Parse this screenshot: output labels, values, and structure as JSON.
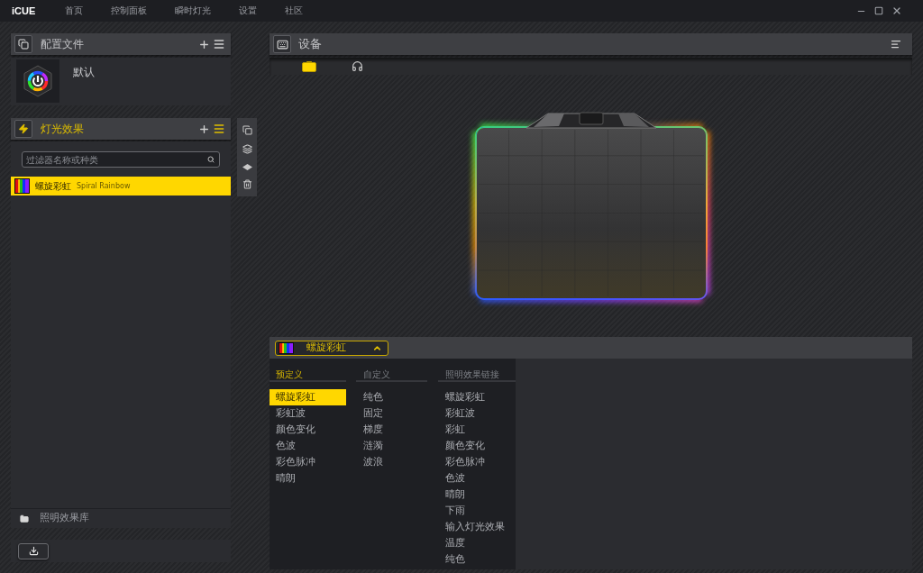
{
  "app": {
    "logo": "iCUE",
    "nav": [
      {
        "label": "首页"
      },
      {
        "label": "控制面板"
      },
      {
        "label": "瞬时灯光"
      },
      {
        "label": "设置"
      },
      {
        "label": "社区"
      }
    ]
  },
  "profiles": {
    "title": "配置文件",
    "active": false,
    "items": [
      {
        "name": "默认"
      }
    ]
  },
  "lighting_effects": {
    "title": "灯光效果",
    "active": true,
    "search": {
      "placeholder": "过滤器名称或种类"
    },
    "items": [
      {
        "name": "螺旋彩虹",
        "type": "Spiral Rainbow",
        "selected": true
      }
    ],
    "library": {
      "label": "照明效果库"
    }
  },
  "devices": {
    "title": "设备",
    "tabs": [
      {
        "kind": "mousepad",
        "selected": true
      },
      {
        "kind": "headset",
        "selected": false
      }
    ]
  },
  "effect_editor": {
    "dropdown": {
      "value": "螺旋彩虹",
      "expanded": true
    },
    "columns": [
      {
        "heading": "预定义",
        "active": true,
        "items": [
          {
            "label": "螺旋彩虹",
            "selected": true
          },
          {
            "label": "彩虹波",
            "selected": false
          },
          {
            "label": "颜色变化",
            "selected": false
          },
          {
            "label": "色波",
            "selected": false
          },
          {
            "label": "彩色脉冲",
            "selected": false
          },
          {
            "label": "晴朗",
            "selected": false
          }
        ]
      },
      {
        "heading": "自定义",
        "active": false,
        "items": [
          {
            "label": "纯色",
            "selected": false
          },
          {
            "label": "固定",
            "selected": false
          },
          {
            "label": "梯度",
            "selected": false
          },
          {
            "label": "涟漪",
            "selected": false
          },
          {
            "label": "波浪",
            "selected": false
          }
        ]
      },
      {
        "heading": "照明效果链接",
        "active": false,
        "items": [
          {
            "label": "螺旋彩虹",
            "selected": false
          },
          {
            "label": "彩虹波",
            "selected": false
          },
          {
            "label": "彩虹",
            "selected": false
          },
          {
            "label": "颜色变化",
            "selected": false
          },
          {
            "label": "彩色脉冲",
            "selected": false
          },
          {
            "label": "色波",
            "selected": false
          },
          {
            "label": "晴朗",
            "selected": false
          },
          {
            "label": "下雨",
            "selected": false
          },
          {
            "label": "输入灯光效果",
            "selected": false
          },
          {
            "label": "温度",
            "selected": false
          },
          {
            "label": "纯色",
            "selected": false
          }
        ]
      }
    ]
  }
}
